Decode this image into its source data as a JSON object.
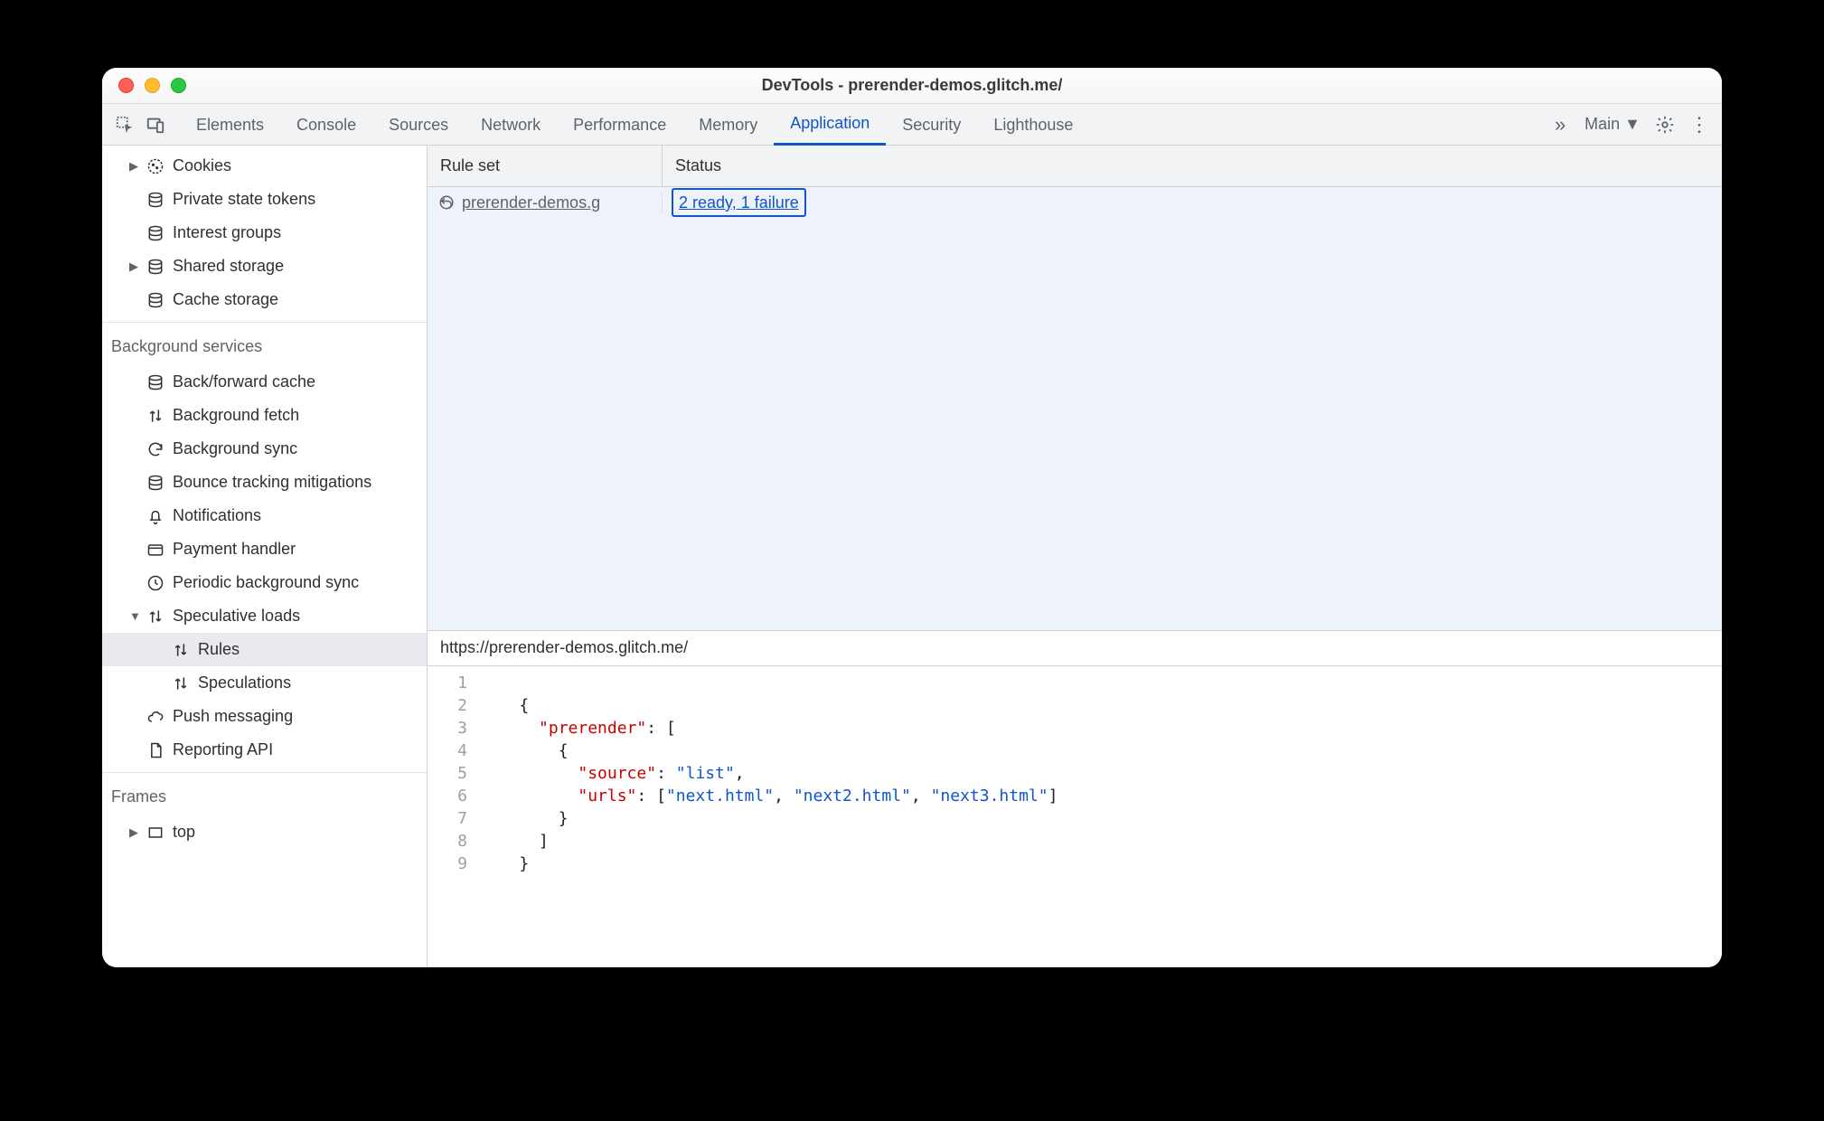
{
  "window": {
    "title": "DevTools - prerender-demos.glitch.me/"
  },
  "toolbar": {
    "tabs": [
      "Elements",
      "Console",
      "Sources",
      "Network",
      "Performance",
      "Memory",
      "Application",
      "Security",
      "Lighthouse"
    ],
    "activeTab": "Application",
    "target": "Main"
  },
  "sidebar": {
    "topItems": [
      {
        "label": "Cookies",
        "icon": "cookies",
        "expandable": true
      },
      {
        "label": "Private state tokens",
        "icon": "db"
      },
      {
        "label": "Interest groups",
        "icon": "db"
      },
      {
        "label": "Shared storage",
        "icon": "db",
        "expandable": true
      },
      {
        "label": "Cache storage",
        "icon": "db"
      }
    ],
    "bgSection": "Background services",
    "bgItems": [
      {
        "label": "Back/forward cache",
        "icon": "db"
      },
      {
        "label": "Background fetch",
        "icon": "updown"
      },
      {
        "label": "Background sync",
        "icon": "sync"
      },
      {
        "label": "Bounce tracking mitigations",
        "icon": "db"
      },
      {
        "label": "Notifications",
        "icon": "bell"
      },
      {
        "label": "Payment handler",
        "icon": "card"
      },
      {
        "label": "Periodic background sync",
        "icon": "clock"
      },
      {
        "label": "Speculative loads",
        "icon": "updown",
        "expanded": true,
        "children": [
          {
            "label": "Rules",
            "icon": "updown",
            "selected": true
          },
          {
            "label": "Speculations",
            "icon": "updown"
          }
        ]
      },
      {
        "label": "Push messaging",
        "icon": "cloud"
      },
      {
        "label": "Reporting API",
        "icon": "doc"
      }
    ],
    "framesSection": "Frames",
    "frames": [
      {
        "label": "top",
        "icon": "frame",
        "expandable": true
      }
    ]
  },
  "grid": {
    "headers": {
      "rule": "Rule set",
      "status": "Status"
    },
    "rows": [
      {
        "ruleLabel": "prerender-demos.g",
        "statusLabel": "2 ready, 1 failure"
      }
    ]
  },
  "detail": {
    "url": "https://prerender-demos.glitch.me/",
    "lines": [
      "1",
      "2",
      "3",
      "4",
      "5",
      "6",
      "7",
      "8",
      "9"
    ],
    "json": {
      "prerender": [
        {
          "source": "list",
          "urls": [
            "next.html",
            "next2.html",
            "next3.html"
          ]
        }
      ]
    },
    "keys": {
      "prerender": "prerender",
      "source": "source",
      "urls": "urls"
    },
    "strings": {
      "list": "list",
      "u1": "next.html",
      "u2": "next2.html",
      "u3": "next3.html"
    }
  }
}
